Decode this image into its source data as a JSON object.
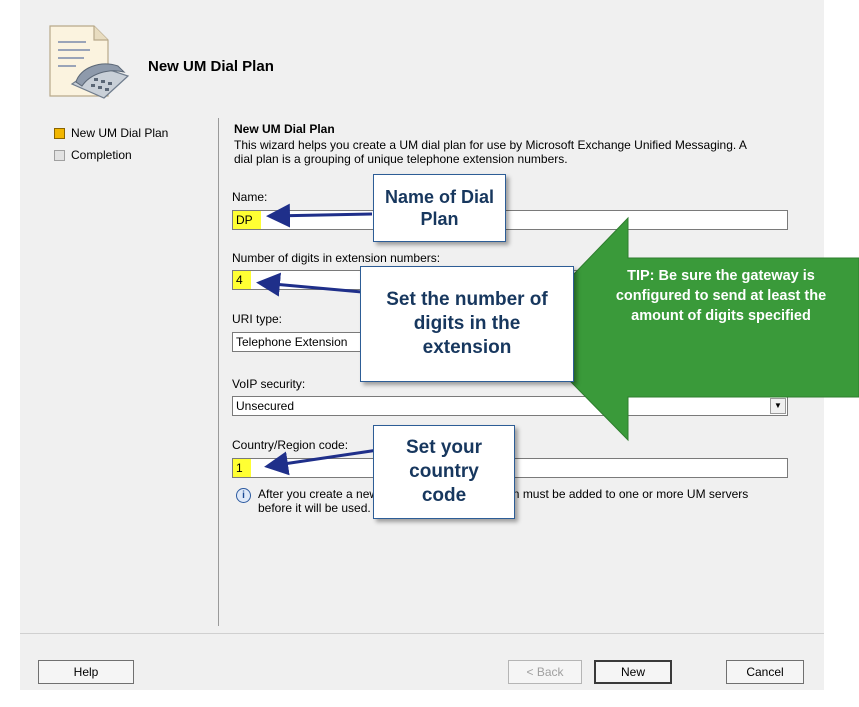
{
  "wizard": {
    "title": "New UM Dial Plan"
  },
  "steps": [
    {
      "label": "New UM Dial Plan",
      "state": "active"
    },
    {
      "label": "Completion",
      "state": "inactive"
    }
  ],
  "content": {
    "title": "New UM Dial Plan",
    "intro": "This wizard helps you create a UM dial plan for use by Microsoft Exchange Unified Messaging. A dial plan is a grouping of unique telephone extension numbers."
  },
  "form": {
    "name_label": "Name:",
    "name_value": "DP",
    "digits_label": "Number of digits in extension numbers:",
    "digits_value": "4",
    "uri_label": "URI type:",
    "uri_value": "Telephone Extension",
    "voip_label": "VoIP security:",
    "voip_value": "Unsecured",
    "country_label": "Country/Region code:",
    "country_value": "1"
  },
  "info": {
    "text": "After you create a new UM dial plan, the dial plan must be added to one or more UM servers before it will be used."
  },
  "buttons": {
    "help": "Help",
    "back": "< Back",
    "new": "New",
    "cancel": "Cancel"
  },
  "callouts": {
    "name": "Name of Dial Plan",
    "digits": "Set the number of digits in the extension",
    "country": "Set your country code",
    "tip": "TIP: Be sure the gateway is configured to send at least the amount of digits specified"
  },
  "colors": {
    "highlight": "#ffff33",
    "callout_text": "#17375e",
    "callout_arrow": "#1f2f8a",
    "tip_green": "#3a9a3a"
  },
  "icons": [
    "phone-document-icon",
    "info-icon",
    "dropdown-arrow-icon",
    "step-active-icon",
    "step-inactive-icon"
  ]
}
